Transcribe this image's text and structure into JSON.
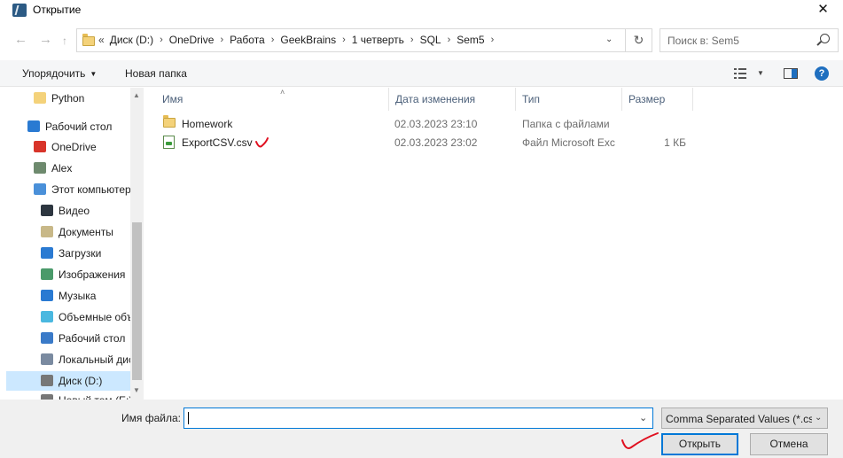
{
  "window": {
    "title": "Открытие",
    "close_glyph": "✕"
  },
  "navigation": {
    "back_glyph": "←",
    "forward_glyph": "→",
    "up_glyph": "↑",
    "recent_glyph": "⌄"
  },
  "address": {
    "lead": "«",
    "breadcrumbs": [
      "Диск (D:)",
      "OneDrive",
      "Работа",
      "GeekBrains",
      "1 четверть",
      "SQL",
      "Sem5"
    ],
    "separator": "›",
    "dropdown_glyph": "⌄",
    "refresh_glyph": "↻"
  },
  "search": {
    "placeholder": "Поиск в: Sem5"
  },
  "toolbar": {
    "organize_label": "Упорядочить",
    "organize_arrow": "▼",
    "new_folder_label": "Новая папка",
    "view_dropdown_glyph": "▼",
    "help_glyph": "?"
  },
  "sidebar": {
    "items": [
      {
        "label": "Python",
        "icon": "folder-icon"
      },
      {
        "label": "Рабочий стол",
        "icon": "desktop-icon"
      },
      {
        "label": "OneDrive",
        "icon": "onedrive-icon"
      },
      {
        "label": "Alex",
        "icon": "user-icon"
      },
      {
        "label": "Этот компьютер",
        "icon": "computer-icon"
      },
      {
        "label": "Видео",
        "icon": "video-icon"
      },
      {
        "label": "Документы",
        "icon": "documents-icon"
      },
      {
        "label": "Загрузки",
        "icon": "downloads-icon"
      },
      {
        "label": "Изображения",
        "icon": "pictures-icon"
      },
      {
        "label": "Музыка",
        "icon": "music-icon"
      },
      {
        "label": "Объемные объекты",
        "icon": "3d-objects-icon"
      },
      {
        "label": "Рабочий стол",
        "icon": "desktop-folder-icon"
      },
      {
        "label": "Локальный диск (C:)",
        "icon": "local-disk-icon"
      },
      {
        "label": "Диск (D:)",
        "icon": "drive-icon",
        "selected": true
      },
      {
        "label": "Новый том (E:)",
        "icon": "drive-icon"
      }
    ],
    "scroll_up_glyph": "▲",
    "scroll_down_glyph": "▼"
  },
  "file_list": {
    "columns": [
      "Имя",
      "Дата изменения",
      "Тип",
      "Размер"
    ],
    "sort_glyph": "˄",
    "rows": [
      {
        "name": "Homework",
        "modified": "02.03.2023 23:10",
        "type": "Папка с файлами",
        "size": "",
        "icon": "folder-icon"
      },
      {
        "name": "ExportCSV.csv",
        "modified": "02.03.2023 23:02",
        "type": "Файл Microsoft Excel",
        "size": "1 КБ",
        "icon": "csv-file-icon"
      }
    ]
  },
  "bottom": {
    "filename_label": "Имя файла:",
    "filename_value": "",
    "filename_dropdown_glyph": "⌄",
    "filetype_value": "Comma Separated Values (*.csv)",
    "filetype_dropdown_glyph": "⌄",
    "open_button": "Открыть",
    "cancel_button": "Отмена"
  },
  "annotation_color": "#e01020"
}
